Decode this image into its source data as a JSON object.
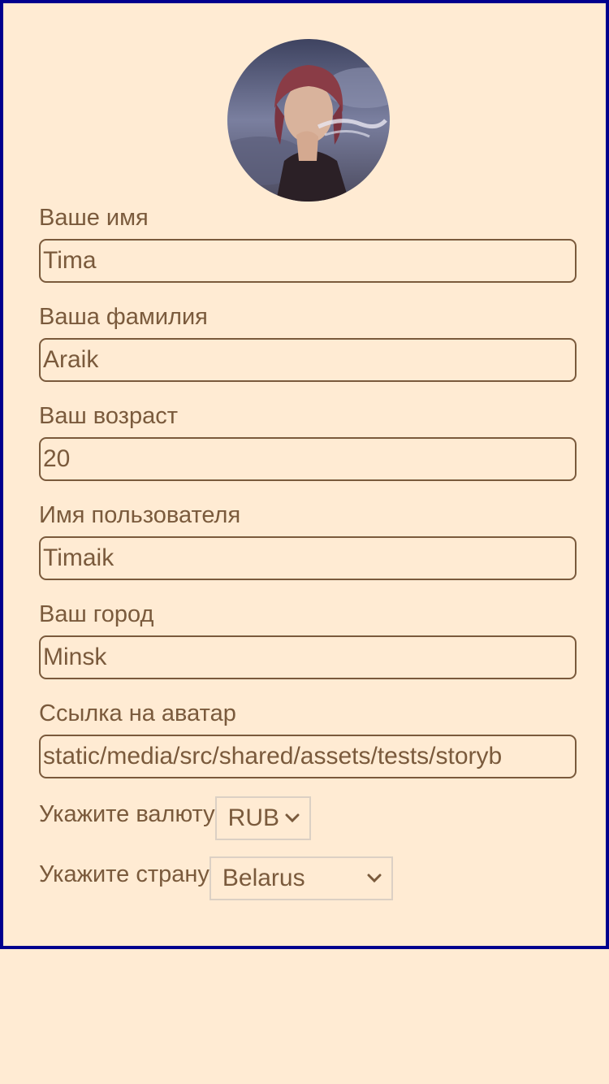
{
  "profile": {
    "first_name_label": "Ваше имя",
    "first_name_value": "Tima",
    "last_name_label": "Ваша фамилия",
    "last_name_value": "Araik",
    "age_label": "Ваш возраст",
    "age_value": "20",
    "username_label": "Имя пользователя",
    "username_value": "Timaik",
    "city_label": "Ваш город",
    "city_value": "Minsk",
    "avatar_label": "Ссылка на аватар",
    "avatar_value": "static/media/src/shared/assets/tests/storyb",
    "currency_label": "Укажите валюту",
    "currency_value": "RUB",
    "country_label": "Укажите страну",
    "country_value": "Belarus"
  },
  "icons": {
    "avatar": "avatar-image",
    "select_arrow": "chevron-down-icon"
  },
  "colors": {
    "background": "#ffebd3",
    "text": "#7a5a3c",
    "card_border": "#00008e",
    "select_border": "#dcd0c4"
  }
}
